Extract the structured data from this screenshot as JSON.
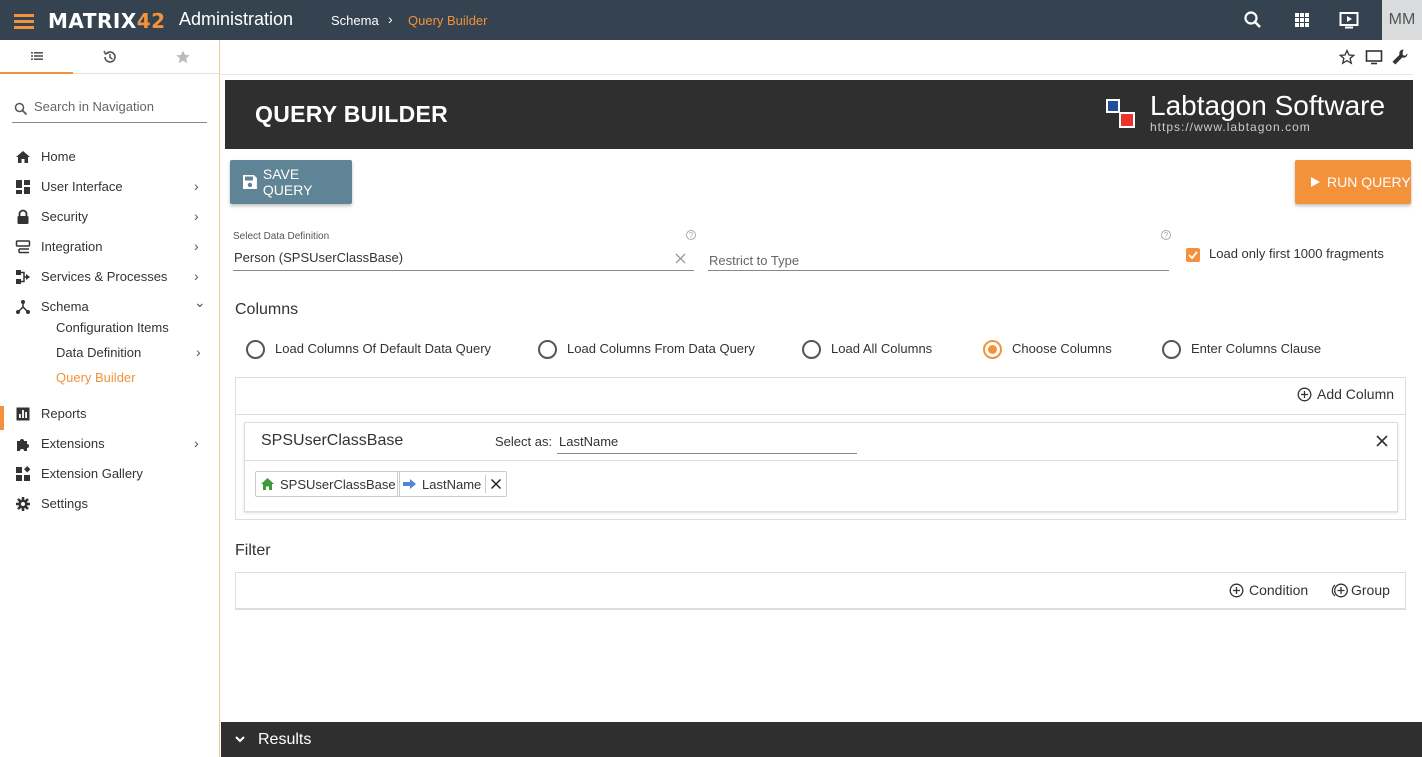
{
  "topbar": {
    "logo_main": "MATRIX",
    "logo_accent": "42",
    "app_title": "Administration",
    "breadcrumb": [
      "Schema",
      "Query Builder"
    ],
    "breadcrumb_sep": "›",
    "avatar": "MM",
    "icons": [
      "menu-icon",
      "search-icon",
      "apps-grid-icon",
      "screen-play-icon"
    ]
  },
  "sidebar": {
    "search_placeholder": "Search in Navigation",
    "items": [
      {
        "label": "Home",
        "icon": "home-icon"
      },
      {
        "label": "User Interface",
        "icon": "dashboard-icon",
        "chevron": "›"
      },
      {
        "label": "Security",
        "icon": "lock-icon",
        "chevron": "›"
      },
      {
        "label": "Integration",
        "icon": "integration-icon",
        "chevron": "›"
      },
      {
        "label": "Services & Processes",
        "icon": "services-icon",
        "chevron": "›"
      },
      {
        "label": "Schema",
        "icon": "schema-icon",
        "chevron": "⌄"
      },
      {
        "label": "Reports",
        "icon": "reports-icon"
      },
      {
        "label": "Extensions",
        "icon": "puzzle-icon",
        "chevron": "›"
      },
      {
        "label": "Extension Gallery",
        "icon": "gallery-icon"
      },
      {
        "label": "Settings",
        "icon": "gear-icon"
      }
    ],
    "schema_children": [
      {
        "label": "Configuration Items"
      },
      {
        "label": "Data Definition",
        "chevron": "›"
      },
      {
        "label": "Query Builder",
        "active": true
      }
    ]
  },
  "header": {
    "title": "QUERY BUILDER",
    "brand": "Labtagon Software",
    "brand_url": "https://www.labtagon.com"
  },
  "buttons": {
    "save": "SAVE QUERY",
    "run": "RUN QUERY"
  },
  "form": {
    "data_definition_label": "Select Data Definition",
    "data_definition_value": "Person (SPSUserClassBase)",
    "restrict_placeholder": "Restrict to Type",
    "load_first_label": "Load only first 1000 fragments",
    "load_first_checked": true
  },
  "columns": {
    "section_title": "Columns",
    "options": [
      {
        "label": "Load Columns Of Default Data Query",
        "selected": false
      },
      {
        "label": "Load Columns From Data Query",
        "selected": false
      },
      {
        "label": "Load All Columns",
        "selected": false
      },
      {
        "label": "Choose Columns",
        "selected": true
      },
      {
        "label": "Enter Columns Clause",
        "selected": false
      }
    ],
    "add_column": "Add Column",
    "card": {
      "class_name": "SPSUserClassBase",
      "select_as_label": "Select as:",
      "select_as_value": "LastName",
      "path": [
        "SPSUserClassBase",
        "LastName"
      ]
    }
  },
  "filter": {
    "section_title": "Filter",
    "condition": "Condition",
    "group": "Group"
  },
  "results": {
    "label": "Results"
  },
  "colors": {
    "accent": "#f3923b",
    "topbar": "#34434f",
    "save_button": "#5f8496",
    "dark": "#2f2f2f"
  }
}
